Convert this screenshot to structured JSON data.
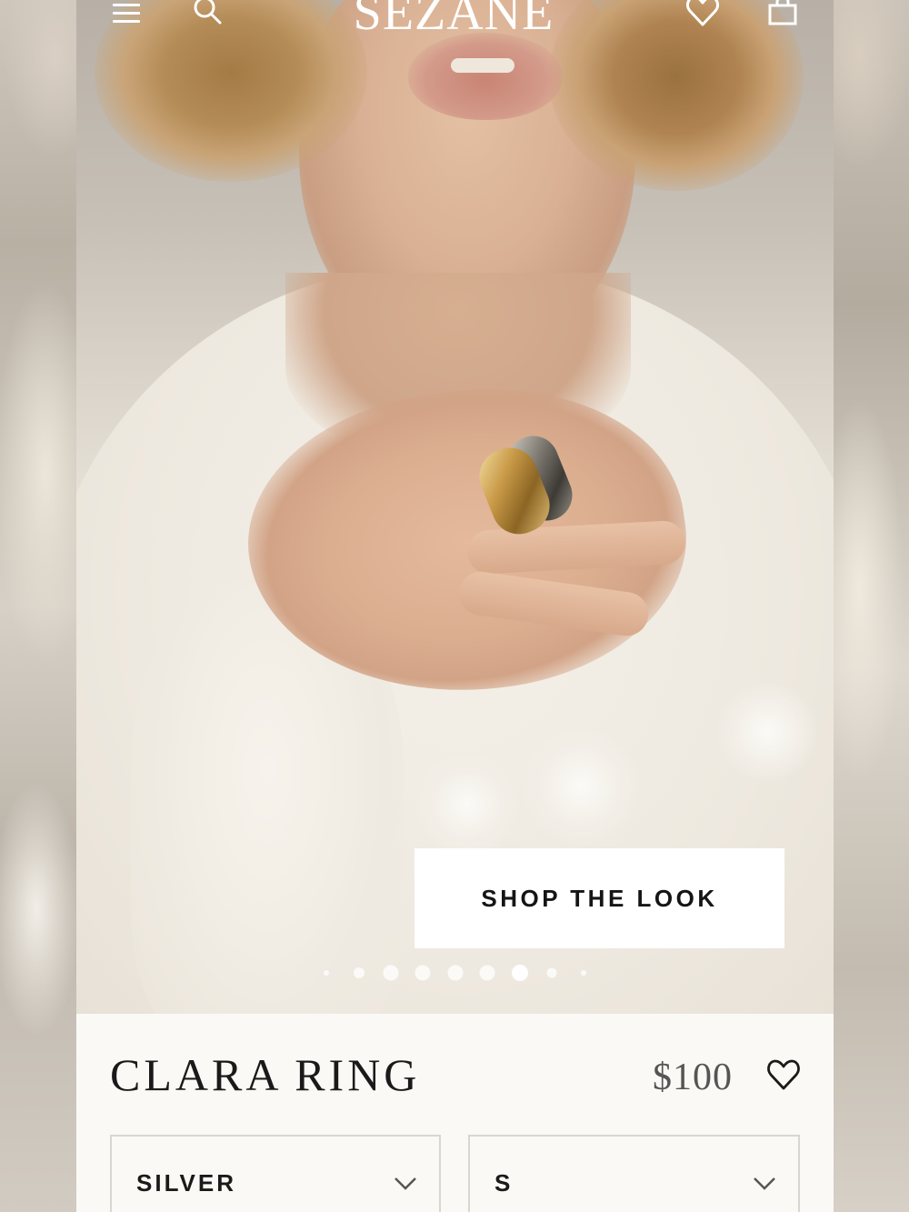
{
  "header": {
    "brand": "SEZANE",
    "icons": [
      "menu-icon",
      "search-icon",
      "heart-icon",
      "bag-icon"
    ]
  },
  "hero": {
    "shop_the_look_label": "SHOP THE LOOK",
    "carousel": {
      "total": 9,
      "active_index": 6
    }
  },
  "product": {
    "name": "CLARA RING",
    "price": "$100",
    "color_select": {
      "value": "SILVER"
    },
    "size_select": {
      "value": "S"
    }
  },
  "colors": {
    "text": "#1a1a1a",
    "button_bg": "#ffffff",
    "panel_bg": "#fbf9f5",
    "border": "#d9d6d0"
  }
}
